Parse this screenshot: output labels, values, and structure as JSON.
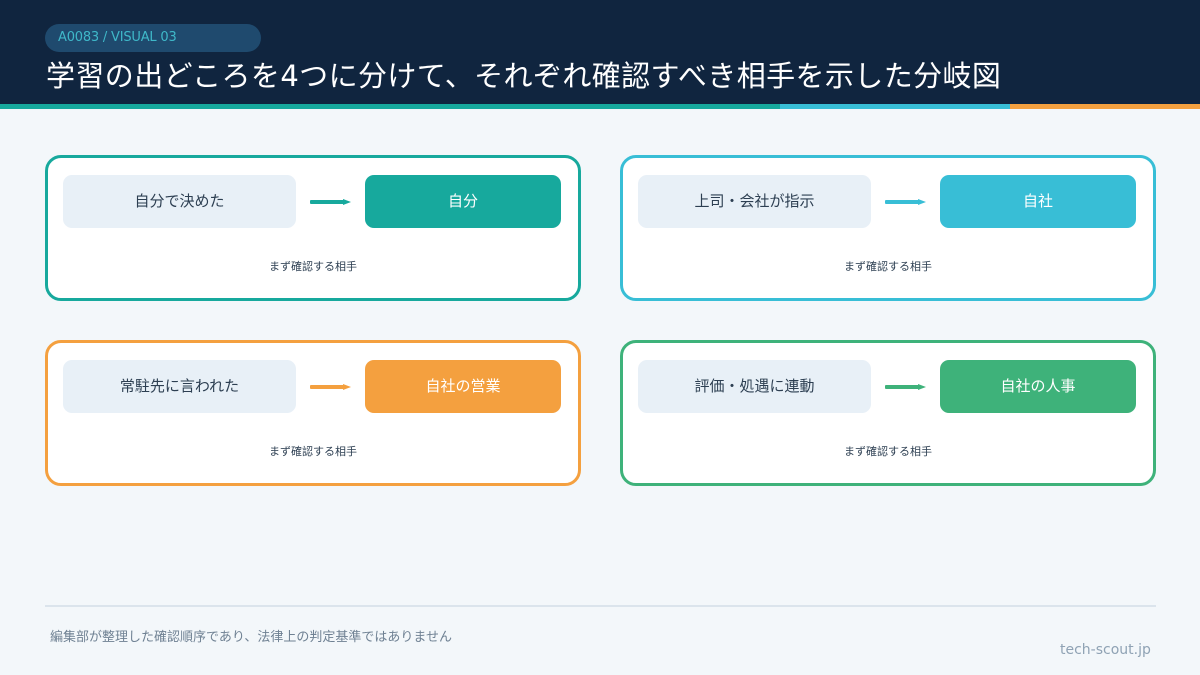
{
  "header": {
    "badge": "A0083 / VISUAL 03",
    "title": "学習の出どころを4つに分けて、それぞれ確認すべき相手を示した分岐図"
  },
  "colors": {
    "teal": "#17a99d",
    "cyan": "#38bed6",
    "orange": "#f4a03f",
    "green": "#3eb27a",
    "header_bg": "#10253f"
  },
  "branches": [
    {
      "source": "自分で決めた",
      "target": "自分",
      "caption": "まず確認する相手",
      "color": "#17a99d"
    },
    {
      "source": "上司・会社が指示",
      "target": "自社",
      "caption": "まず確認する相手",
      "color": "#38bed6"
    },
    {
      "source": "常駐先に言われた",
      "target": "自社の営業",
      "caption": "まず確認する相手",
      "color": "#f4a03f"
    },
    {
      "source": "評価・処遇に連動",
      "target": "自社の人事",
      "caption": "まず確認する相手",
      "color": "#3eb27a"
    }
  ],
  "footer": {
    "note": "編集部が整理した確認順序であり、法律上の判定基準ではありません",
    "site": "tech-scout.jp"
  }
}
